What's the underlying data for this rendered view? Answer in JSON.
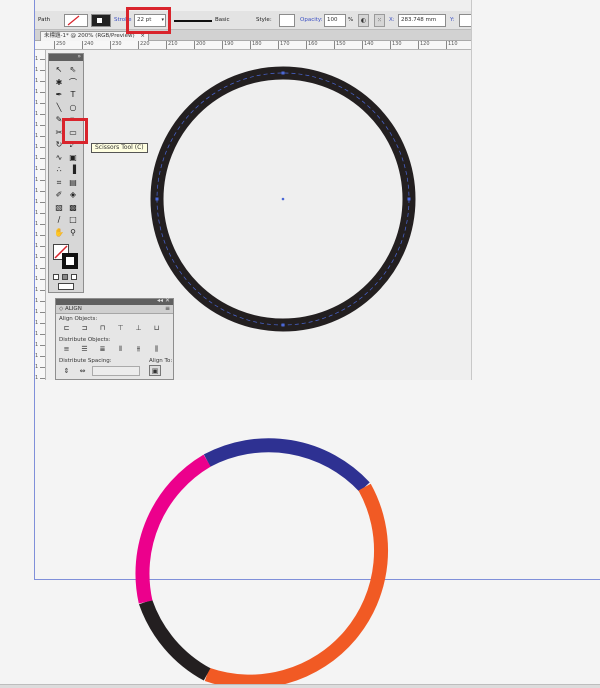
{
  "control_bar": {
    "selection_label": "Path",
    "stroke_weight_label": "Stroke",
    "stroke_weight_value": "22 pt",
    "brush_label": "Basic",
    "style_label": "Style:",
    "opacity_label": "Opacity:",
    "opacity_value": "100",
    "opacity_unit": "%",
    "x_label": "X:",
    "x_value": "283.748 mm",
    "y_label": "Y:"
  },
  "document": {
    "tab_title": "未標題-1* @ 200% (RGB/Preview)",
    "close_glyph": "×"
  },
  "ruler": {
    "top_labels": [
      "250",
      "240",
      "230",
      "220",
      "210",
      "200",
      "190",
      "180",
      "170",
      "160",
      "150",
      "140",
      "130",
      "120",
      "110"
    ],
    "left_labels": [
      "1",
      "1",
      "1",
      "1",
      "1",
      "1",
      "1",
      "1",
      "1",
      "1",
      "1",
      "1",
      "1",
      "1",
      "1",
      "1",
      "1",
      "1",
      "1",
      "1",
      "1",
      "1",
      "1",
      "1",
      "1",
      "1",
      "1",
      "1",
      "1",
      "1"
    ]
  },
  "tools": {
    "items": [
      {
        "name": "selection-tool-icon",
        "glyph": "↖"
      },
      {
        "name": "direct-selection-tool-icon",
        "glyph": "⇖"
      },
      {
        "name": "magic-wand-tool-icon",
        "glyph": "✱"
      },
      {
        "name": "lasso-tool-icon",
        "glyph": "⌒"
      },
      {
        "name": "pen-tool-icon",
        "glyph": "✒"
      },
      {
        "name": "type-tool-icon",
        "glyph": "T"
      },
      {
        "name": "line-tool-icon",
        "glyph": "╲"
      },
      {
        "name": "ellipse-tool-icon",
        "glyph": "○"
      },
      {
        "name": "paintbrush-tool-icon",
        "glyph": "✎"
      },
      {
        "name": "pencil-tool-icon",
        "glyph": "✏"
      },
      {
        "name": "scissors-tool-icon",
        "glyph": "✂"
      },
      {
        "name": "eraser-tool-icon",
        "glyph": "▭"
      },
      {
        "name": "rotate-tool-icon",
        "glyph": "↻"
      },
      {
        "name": "scale-tool-icon",
        "glyph": "⤢"
      },
      {
        "name": "warp-tool-icon",
        "glyph": "∿"
      },
      {
        "name": "free-transform-tool-icon",
        "glyph": "▣"
      },
      {
        "name": "symbol-sprayer-tool-icon",
        "glyph": "∴"
      },
      {
        "name": "column-graph-tool-icon",
        "glyph": "▐"
      },
      {
        "name": "mesh-tool-icon",
        "glyph": "⌗"
      },
      {
        "name": "gradient-tool-icon",
        "glyph": "▤"
      },
      {
        "name": "eyedropper-tool-icon",
        "glyph": "✐"
      },
      {
        "name": "blend-tool-icon",
        "glyph": "◈"
      },
      {
        "name": "live-paint-tool-icon",
        "glyph": "▧"
      },
      {
        "name": "live-paint-select-tool-icon",
        "glyph": "▩"
      },
      {
        "name": "slice-tool-icon",
        "glyph": "∕"
      },
      {
        "name": "artboard-tool-icon",
        "glyph": "□"
      },
      {
        "name": "hand-tool-icon",
        "glyph": "✋"
      },
      {
        "name": "zoom-tool-icon",
        "glyph": "⚲"
      }
    ],
    "tooltip": "Scissors Tool (C)"
  },
  "align_panel": {
    "title": "◇ ALIGN",
    "align_objects_label": "Align Objects:",
    "distribute_objects_label": "Distribute Objects:",
    "distribute_spacing_label": "Distribute Spacing:",
    "align_to_label": "Align To:"
  },
  "artwork": {
    "stroke_color": "#231f20",
    "path_color": "#4a67d6",
    "segment_colors": [
      "#2e3192",
      "#f15a24",
      "#231f20",
      "#ec008c"
    ]
  }
}
